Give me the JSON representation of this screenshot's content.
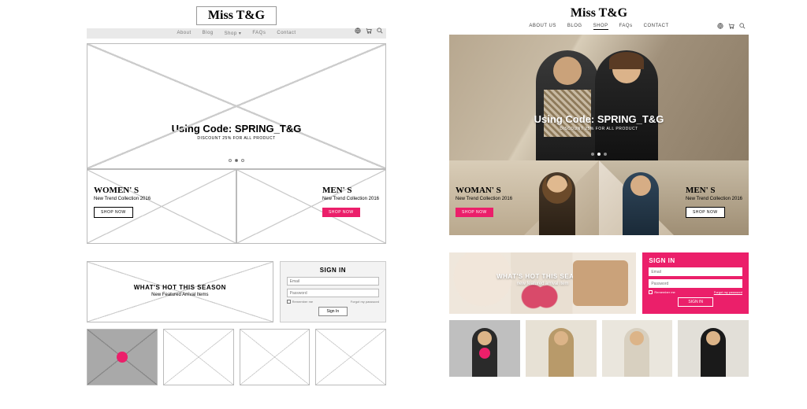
{
  "brand": "Miss T&G",
  "nav": {
    "items": [
      "ABOUT US",
      "BLOG",
      "SHOP",
      "FAQs",
      "CONTACT"
    ],
    "wf_items": [
      "About",
      "Blog",
      "Shop ▾",
      "FAQs",
      "Contact"
    ],
    "active_index": 2
  },
  "icons": {
    "globe": "globe-icon",
    "cart": "cart-icon",
    "search": "search-icon"
  },
  "hero": {
    "code_line": "Using Code: SPRING_T&G",
    "sub": "DISCOUNT 25% FOR ALL PRODUCT",
    "slide_count": 3,
    "active_slide": 1
  },
  "categories": {
    "women": {
      "title_wf": "WOMEN' S",
      "title": "WOMAN' S",
      "sub": "New Trend\nCollection 2016",
      "btn": "SHOP NOW"
    },
    "men": {
      "title": "MEN' S",
      "sub": "New Trend\nCollection 2016",
      "btn": "SHOP NOW"
    }
  },
  "hot": {
    "title": "WHAT'S HOT THIS SEASON",
    "sub_wf": "New Featured Arrival Items",
    "sub": "new featured arrival item"
  },
  "signin": {
    "title": "SIGN IN",
    "email_ph": "Email",
    "pass_ph": "Password",
    "remember": "Remember me",
    "forgot": "Forgot my password",
    "btn": "Sign In"
  },
  "colors": {
    "accent": "#eb1f6a"
  }
}
